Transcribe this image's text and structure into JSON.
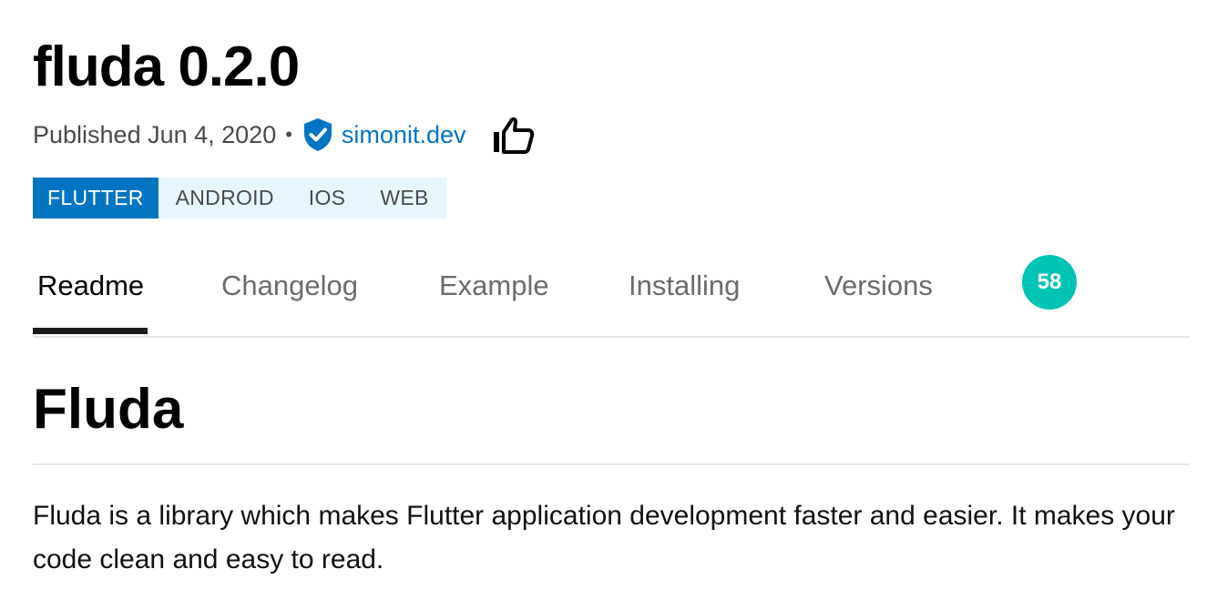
{
  "package": {
    "title": "fluda 0.2.0"
  },
  "meta": {
    "published": "Published Jun 4, 2020",
    "separator": "•",
    "publisher": "simonit.dev",
    "verified_icon": "verified-shield-icon",
    "like_icon": "thumbs-up-icon"
  },
  "platforms": {
    "primary": "FLUTTER",
    "items": [
      "ANDROID",
      "IOS",
      "WEB"
    ]
  },
  "tabs": {
    "items": [
      "Readme",
      "Changelog",
      "Example",
      "Installing",
      "Versions"
    ],
    "active": "Readme",
    "score": "58"
  },
  "readme": {
    "heading": "Fluda",
    "paragraph": "Fluda is a library which makes Flutter application development faster and easier. It makes your code clean and easy to read."
  },
  "colors": {
    "accent": "#0175c2",
    "tag_background": "#e7f6fd",
    "score_badge": "#00c4b3"
  }
}
